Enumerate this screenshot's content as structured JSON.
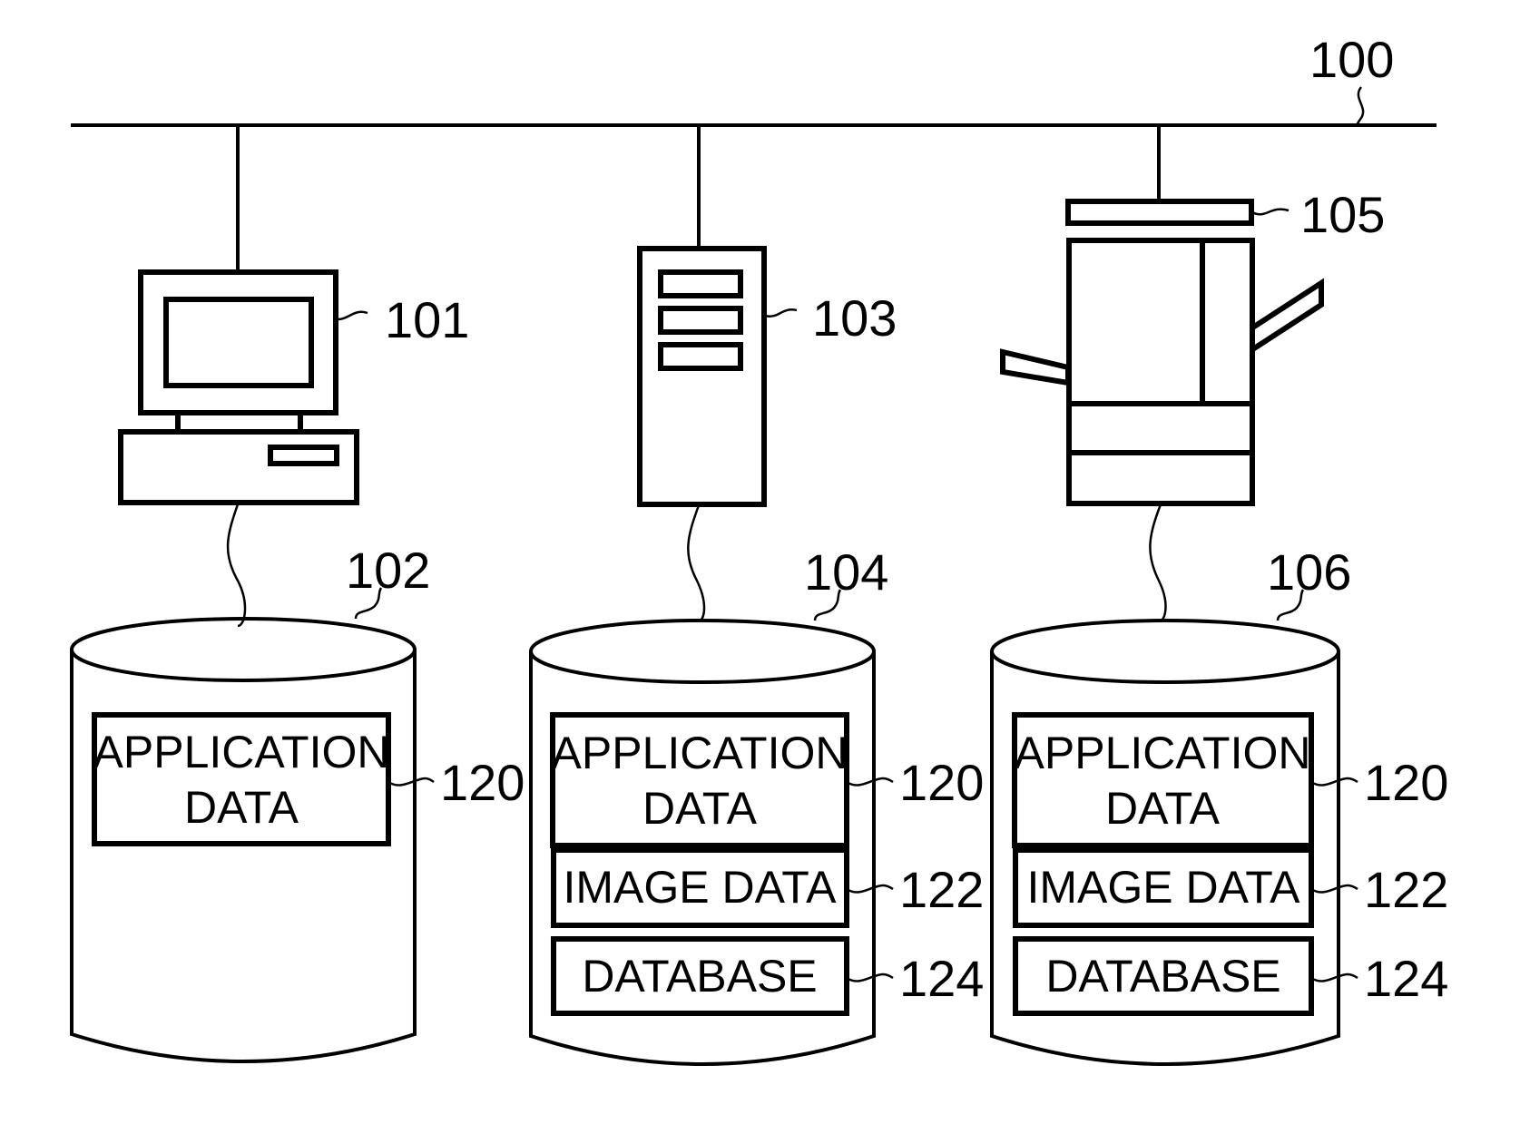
{
  "diagram": {
    "network": {
      "ref": "100"
    },
    "devices": [
      {
        "id": "pc",
        "kind": "personal-computer",
        "ref": "101"
      },
      {
        "id": "server",
        "kind": "server",
        "ref": "103"
      },
      {
        "id": "mfp",
        "kind": "multifunction-peripheral",
        "ref": "105"
      }
    ],
    "storages": [
      {
        "ref": "102",
        "blocks": [
          {
            "lines": [
              "APPLICATION",
              "DATA"
            ],
            "ref": "120"
          }
        ]
      },
      {
        "ref": "104",
        "blocks": [
          {
            "lines": [
              "APPLICATION",
              "DATA"
            ],
            "ref": "120"
          },
          {
            "lines": [
              "IMAGE DATA"
            ],
            "ref": "122"
          },
          {
            "lines": [
              "DATABASE"
            ],
            "ref": "124"
          }
        ]
      },
      {
        "ref": "106",
        "blocks": [
          {
            "lines": [
              "APPLICATION",
              "DATA"
            ],
            "ref": "120"
          },
          {
            "lines": [
              "IMAGE DATA"
            ],
            "ref": "122"
          },
          {
            "lines": [
              "DATABASE"
            ],
            "ref": "124"
          }
        ]
      }
    ]
  }
}
